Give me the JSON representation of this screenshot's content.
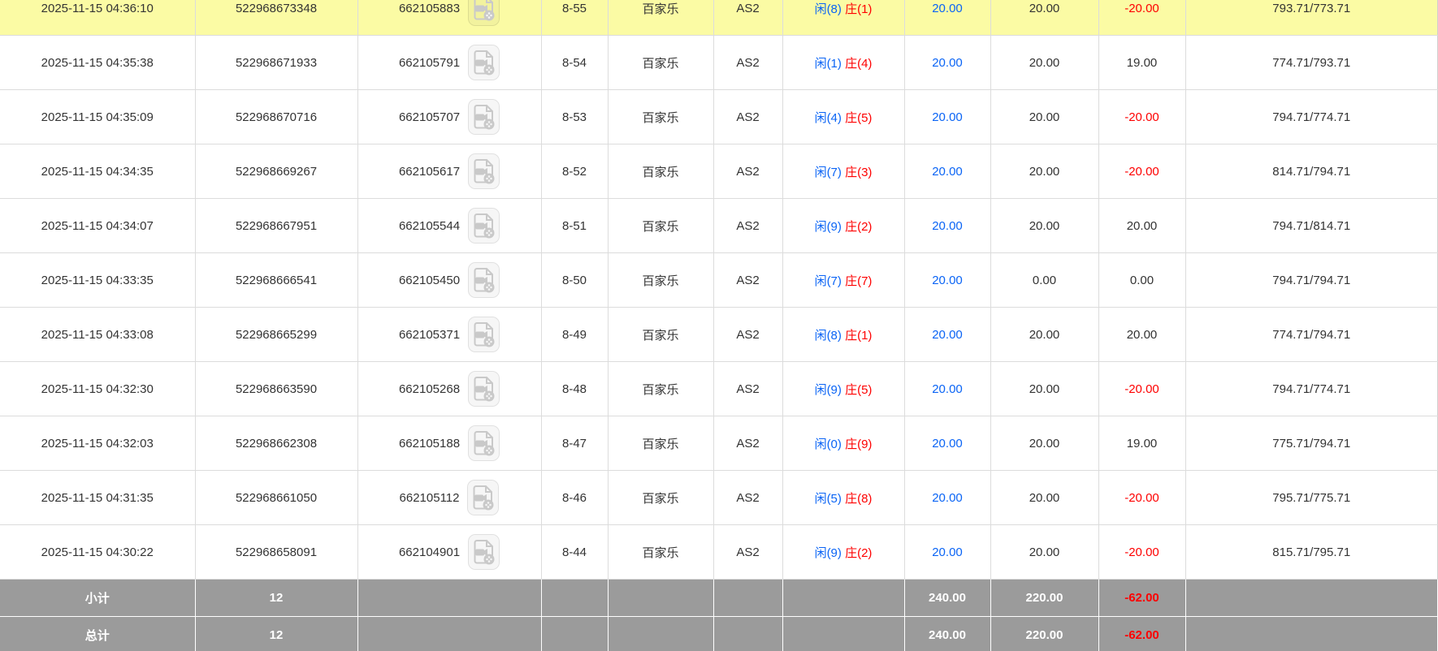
{
  "colors": {
    "highlight": "#fbfba4",
    "player_blue": "#0a64f5",
    "banker_red": "#fe0000",
    "negative_red": "#fe0000",
    "amount_blue": "#0a64f5",
    "summary_bg": "#9b9b9b",
    "border": "#dcdcdc",
    "text": "#333333"
  },
  "icons": {
    "video_icon": "video-replay-icon"
  },
  "table": {
    "game_label": "百家乐",
    "table_label": "AS2",
    "rows": [
      {
        "time": "2025-11-15 04:36:10",
        "bet_no": "522968673348",
        "round_no": "662105883",
        "table_round": "8-55",
        "game": "百家乐",
        "table_id": "AS2",
        "result_player": "闲(8)",
        "result_banker": "庄(1)",
        "bet_amount": "20.00",
        "valid_amount": "20.00",
        "win_loss": "-20.00",
        "balance": "793.71/773.71",
        "highlight": true
      },
      {
        "time": "2025-11-15 04:35:38",
        "bet_no": "522968671933",
        "round_no": "662105791",
        "table_round": "8-54",
        "game": "百家乐",
        "table_id": "AS2",
        "result_player": "闲(1)",
        "result_banker": "庄(4)",
        "bet_amount": "20.00",
        "valid_amount": "20.00",
        "win_loss": "19.00",
        "balance": "774.71/793.71",
        "highlight": false
      },
      {
        "time": "2025-11-15 04:35:09",
        "bet_no": "522968670716",
        "round_no": "662105707",
        "table_round": "8-53",
        "game": "百家乐",
        "table_id": "AS2",
        "result_player": "闲(4)",
        "result_banker": "庄(5)",
        "bet_amount": "20.00",
        "valid_amount": "20.00",
        "win_loss": "-20.00",
        "balance": "794.71/774.71",
        "highlight": false
      },
      {
        "time": "2025-11-15 04:34:35",
        "bet_no": "522968669267",
        "round_no": "662105617",
        "table_round": "8-52",
        "game": "百家乐",
        "table_id": "AS2",
        "result_player": "闲(7)",
        "result_banker": "庄(3)",
        "bet_amount": "20.00",
        "valid_amount": "20.00",
        "win_loss": "-20.00",
        "balance": "814.71/794.71",
        "highlight": false
      },
      {
        "time": "2025-11-15 04:34:07",
        "bet_no": "522968667951",
        "round_no": "662105544",
        "table_round": "8-51",
        "game": "百家乐",
        "table_id": "AS2",
        "result_player": "闲(9)",
        "result_banker": "庄(2)",
        "bet_amount": "20.00",
        "valid_amount": "20.00",
        "win_loss": "20.00",
        "balance": "794.71/814.71",
        "highlight": false
      },
      {
        "time": "2025-11-15 04:33:35",
        "bet_no": "522968666541",
        "round_no": "662105450",
        "table_round": "8-50",
        "game": "百家乐",
        "table_id": "AS2",
        "result_player": "闲(7)",
        "result_banker": "庄(7)",
        "bet_amount": "20.00",
        "valid_amount": "0.00",
        "win_loss": "0.00",
        "balance": "794.71/794.71",
        "highlight": false
      },
      {
        "time": "2025-11-15 04:33:08",
        "bet_no": "522968665299",
        "round_no": "662105371",
        "table_round": "8-49",
        "game": "百家乐",
        "table_id": "AS2",
        "result_player": "闲(8)",
        "result_banker": "庄(1)",
        "bet_amount": "20.00",
        "valid_amount": "20.00",
        "win_loss": "20.00",
        "balance": "774.71/794.71",
        "highlight": false
      },
      {
        "time": "2025-11-15 04:32:30",
        "bet_no": "522968663590",
        "round_no": "662105268",
        "table_round": "8-48",
        "game": "百家乐",
        "table_id": "AS2",
        "result_player": "闲(9)",
        "result_banker": "庄(5)",
        "bet_amount": "20.00",
        "valid_amount": "20.00",
        "win_loss": "-20.00",
        "balance": "794.71/774.71",
        "highlight": false
      },
      {
        "time": "2025-11-15 04:32:03",
        "bet_no": "522968662308",
        "round_no": "662105188",
        "table_round": "8-47",
        "game": "百家乐",
        "table_id": "AS2",
        "result_player": "闲(0)",
        "result_banker": "庄(9)",
        "bet_amount": "20.00",
        "valid_amount": "20.00",
        "win_loss": "19.00",
        "balance": "775.71/794.71",
        "highlight": false
      },
      {
        "time": "2025-11-15 04:31:35",
        "bet_no": "522968661050",
        "round_no": "662105112",
        "table_round": "8-46",
        "game": "百家乐",
        "table_id": "AS2",
        "result_player": "闲(5)",
        "result_banker": "庄(8)",
        "bet_amount": "20.00",
        "valid_amount": "20.00",
        "win_loss": "-20.00",
        "balance": "795.71/775.71",
        "highlight": false
      },
      {
        "time": "2025-11-15 04:30:22",
        "bet_no": "522968658091",
        "round_no": "662104901",
        "table_round": "8-44",
        "game": "百家乐",
        "table_id": "AS2",
        "result_player": "闲(9)",
        "result_banker": "庄(2)",
        "bet_amount": "20.00",
        "valid_amount": "20.00",
        "win_loss": "-20.00",
        "balance": "815.71/795.71",
        "highlight": false
      }
    ],
    "summary_rows": [
      {
        "label": "小计",
        "count": "12",
        "bet_amount": "240.00",
        "valid_amount": "220.00",
        "win_loss": "-62.00"
      },
      {
        "label": "总计",
        "count": "12",
        "bet_amount": "240.00",
        "valid_amount": "220.00",
        "win_loss": "-62.00"
      }
    ]
  }
}
